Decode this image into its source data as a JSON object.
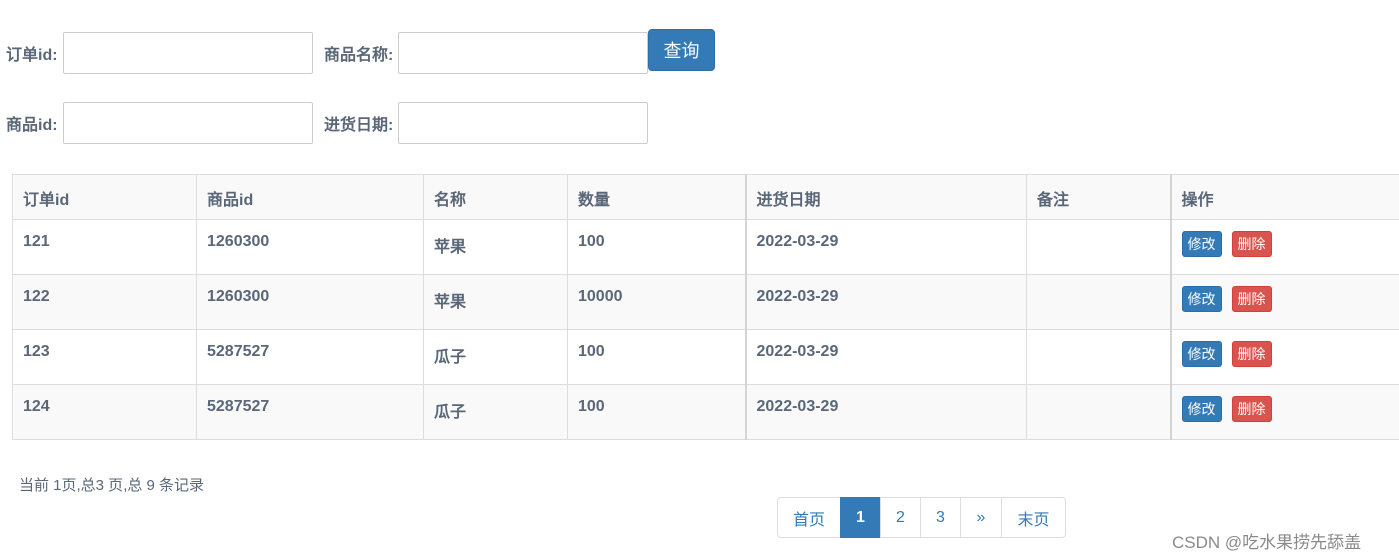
{
  "search": {
    "order_id_label": "订单id:",
    "product_name_label": "商品名称:",
    "product_id_label": "商品id:",
    "stock_date_label": "进货日期:",
    "order_id_value": "",
    "product_name_value": "",
    "product_id_value": "",
    "stock_date_value": "",
    "query_button": "查询"
  },
  "table": {
    "columns": [
      "订单id",
      "商品id",
      "名称",
      "数量",
      "进货日期",
      "备注",
      "操作"
    ],
    "rows": [
      {
        "order_id": "121",
        "product_id": "1260300",
        "name": "苹果",
        "qty": "100",
        "date": "2022-03-29",
        "note": ""
      },
      {
        "order_id": "122",
        "product_id": "1260300",
        "name": "苹果",
        "qty": "10000",
        "date": "2022-03-29",
        "note": ""
      },
      {
        "order_id": "123",
        "product_id": "5287527",
        "name": "瓜子",
        "qty": "100",
        "date": "2022-03-29",
        "note": ""
      },
      {
        "order_id": "124",
        "product_id": "5287527",
        "name": "瓜子",
        "qty": "100",
        "date": "2022-03-29",
        "note": ""
      }
    ],
    "edit_label": "修改",
    "delete_label": "删除"
  },
  "footer": {
    "page_info": "当前 1页,总3 页,总 9 条记录",
    "pager": [
      "首页",
      "1",
      "2",
      "3",
      "»",
      "末页"
    ],
    "active_page": "1"
  },
  "watermark": "CSDN @吃水果捞先舔盖"
}
